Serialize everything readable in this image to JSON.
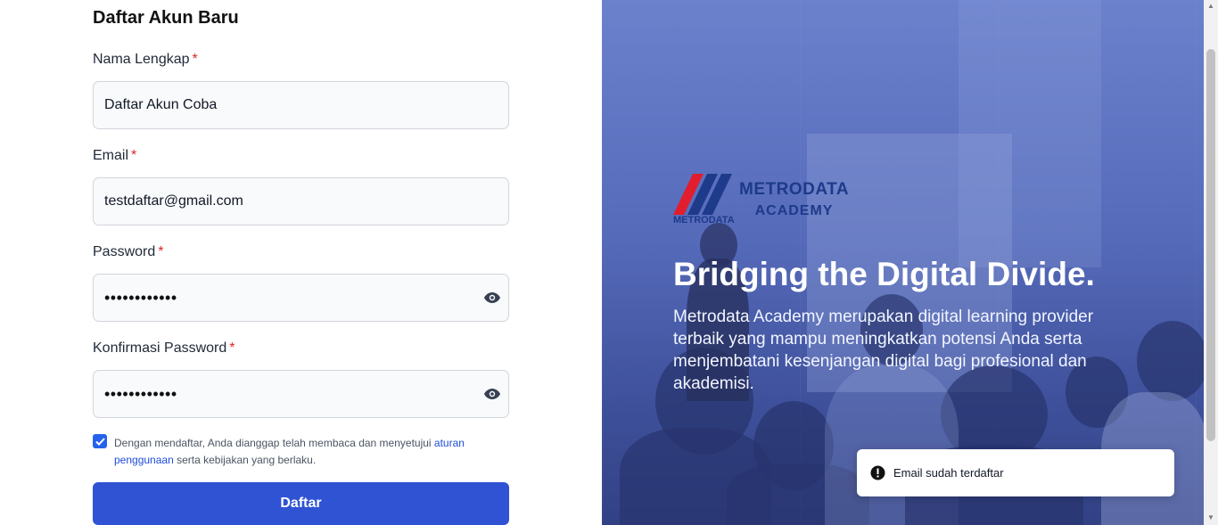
{
  "form": {
    "title": "Daftar Akun Baru",
    "fields": [
      {
        "label": "Nama Lengkap",
        "required": "*",
        "value": "Daftar Akun Coba"
      },
      {
        "label": "Email",
        "required": "*",
        "value": "testdaftar@gmail.com"
      },
      {
        "label": "Password",
        "required": "*",
        "value": "••••••••••••"
      },
      {
        "label": "Konfirmasi Password",
        "required": "*",
        "value": "••••••••••••"
      }
    ],
    "terms": {
      "checked": true,
      "text_before": "Dengan mendaftar, Anda dianggap telah membaca dan menyetujui ",
      "link": "aturan penggunaan",
      "text_after": " serta kebijakan yang berlaku."
    },
    "submit_label": "Daftar"
  },
  "hero": {
    "logo_title": "METRODATA",
    "logo_subtitle": "ACADEMY",
    "logo_mark_text": "METRODATA",
    "headline": "Bridging the Digital Divide.",
    "description": "Metrodata Academy merupakan digital learning provider terbaik yang mampu meningkatkan potensi Anda serta menjembatani kesenjangan digital bagi profesional dan akademisi."
  },
  "toast": {
    "icon": "alert-circle-icon",
    "message": "Email sudah terdaftar"
  },
  "colors": {
    "primary": "#3053d4",
    "required": "#dc2626",
    "link": "#1d4ed8"
  }
}
